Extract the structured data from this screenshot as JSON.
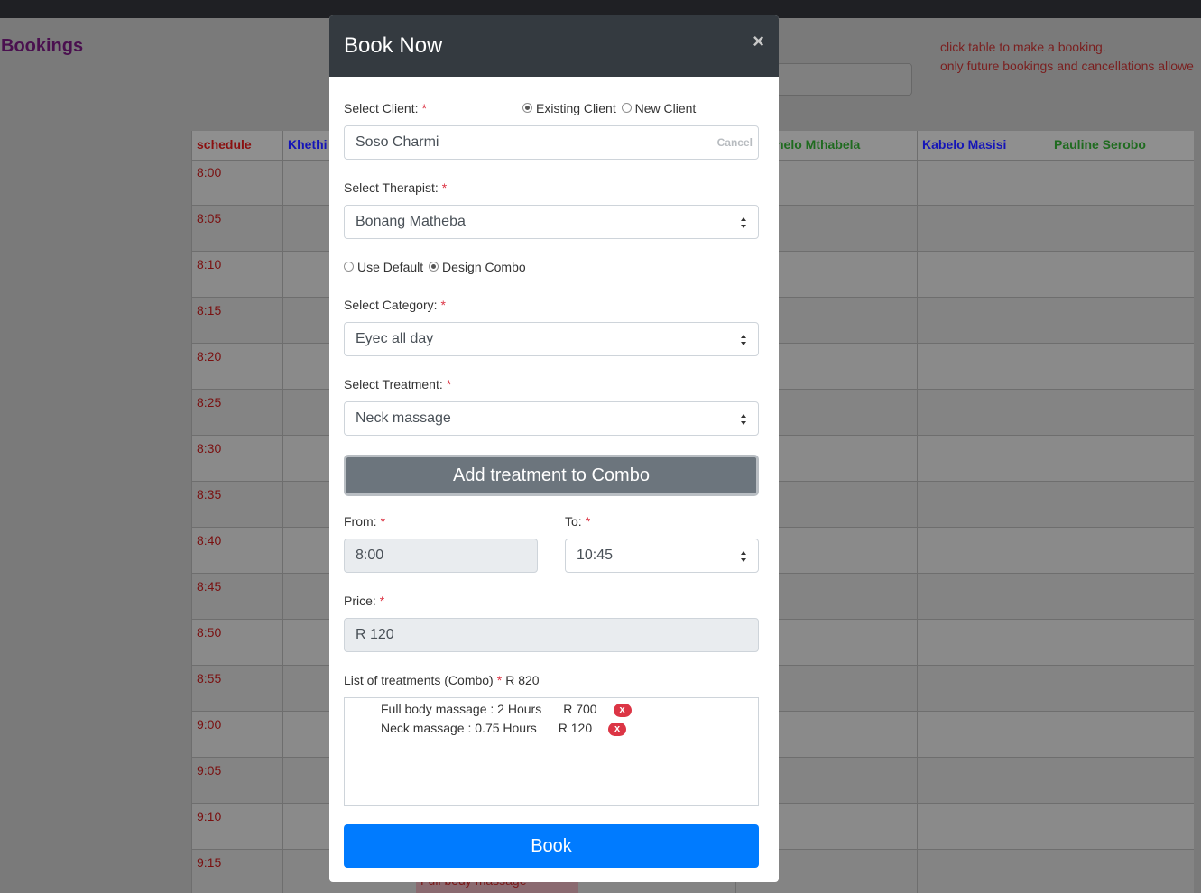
{
  "page": {
    "title": "Bookings",
    "notes": [
      "click table to make a booking.",
      "only future bookings and cancellations allowe"
    ]
  },
  "schedule": {
    "header": "schedule",
    "columns": [
      {
        "name": "Khethi",
        "color": "#1414b8"
      },
      {
        "name": "helo Mthabela",
        "color": "#1f6b1f"
      },
      {
        "name": "Kabelo Masisi",
        "color": "#1414b8"
      },
      {
        "name": "Pauline Serobo",
        "color": "#1f6b1f"
      }
    ],
    "times": [
      "8:00",
      "8:05",
      "8:10",
      "8:15",
      "8:20",
      "8:25",
      "8:30",
      "8:35",
      "8:40",
      "8:45",
      "8:50",
      "8:55",
      "9:00",
      "9:05",
      "9:10",
      "9:15"
    ],
    "visible_booking": "Full body massage"
  },
  "modal": {
    "title": "Book Now",
    "close": "×",
    "client": {
      "label": "Select Client:",
      "required": "*",
      "option_existing": "Existing Client",
      "option_new": "New Client",
      "selected": "existing",
      "value": "Soso Charmi",
      "cancel": "Cancel"
    },
    "therapist": {
      "label": "Select Therapist:",
      "required": "*",
      "value": "Bonang Matheba"
    },
    "mode": {
      "option_default": "Use Default",
      "option_combo": "Design Combo",
      "selected": "combo"
    },
    "category": {
      "label": "Select Category:",
      "required": "*",
      "value": "Eyec all day"
    },
    "treatment": {
      "label": "Select Treatment:",
      "required": "*",
      "value": "Neck massage"
    },
    "add_button": "Add treatment to Combo",
    "from": {
      "label": "From:",
      "required": "*",
      "value": "8:00"
    },
    "to": {
      "label": "To:",
      "required": "*",
      "value": "10:45"
    },
    "price": {
      "label": "Price:",
      "required": "*",
      "value": "R 120"
    },
    "combo": {
      "label": "List of treatments (Combo)",
      "required": "*",
      "total": "R 820",
      "items": [
        {
          "text": "Full body massage : 2 Hours",
          "price": "R 700",
          "remove": "x"
        },
        {
          "text": "Neck massage : 0.75 Hours",
          "price": "R 120",
          "remove": "x"
        }
      ]
    },
    "book_button": "Book"
  }
}
